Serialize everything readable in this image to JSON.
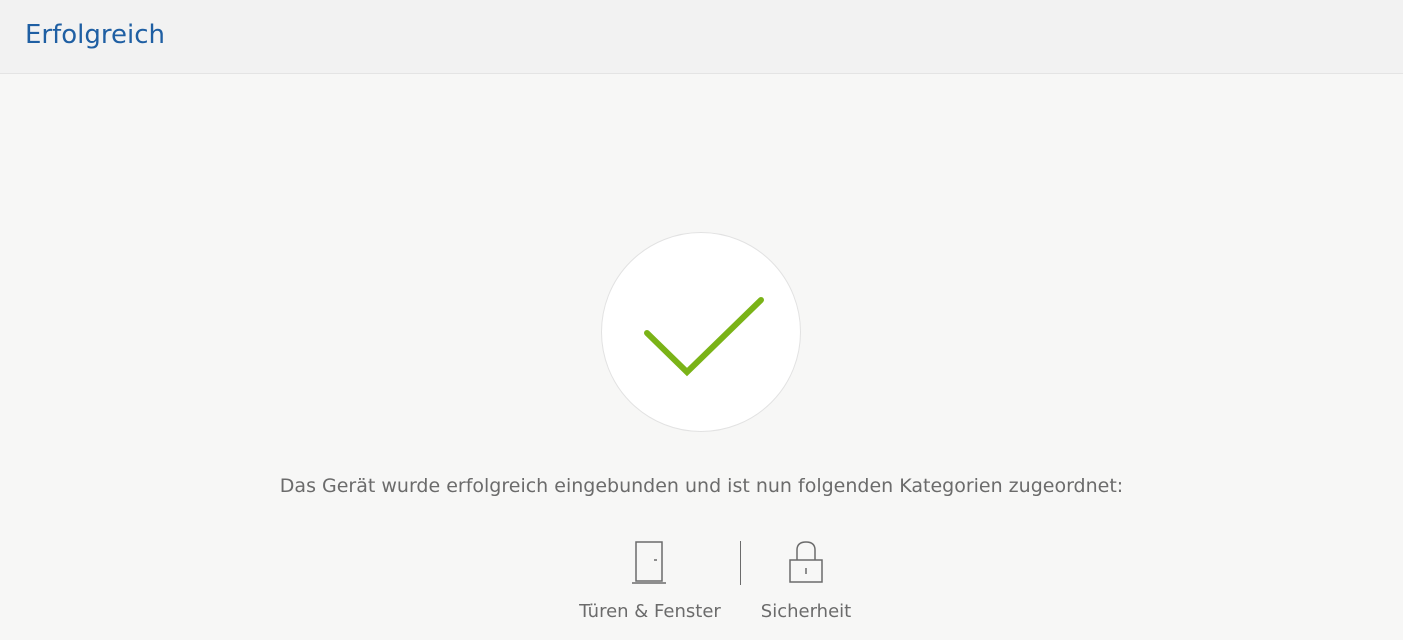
{
  "header": {
    "title": "Erfolgreich"
  },
  "status": {
    "icon": "checkmark-icon",
    "check_color": "#7ab317"
  },
  "message": "Das Gerät wurde erfolgreich eingebunden und ist nun folgenden Kategorien zugeordnet:",
  "categories": [
    {
      "label": "Türen & Fenster",
      "icon": "door-icon"
    },
    {
      "label": "Sicherheit",
      "icon": "lock-icon"
    }
  ],
  "colors": {
    "title": "#1f5fa3",
    "text": "#6b6b6b",
    "background": "#f7f7f6"
  }
}
